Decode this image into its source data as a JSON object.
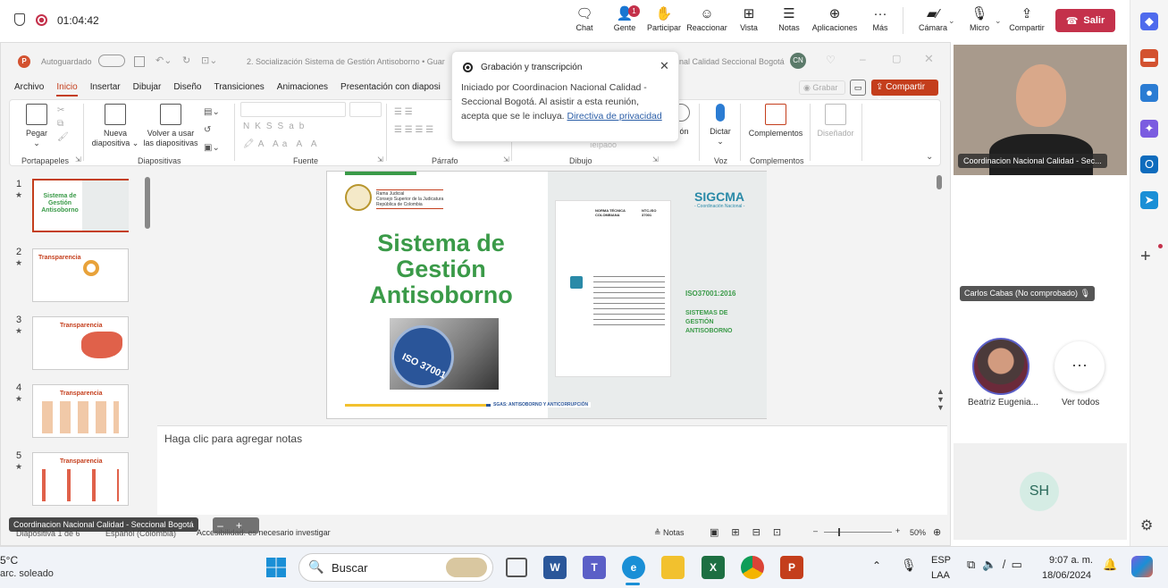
{
  "teams": {
    "timer": "01:04:42",
    "toolbar": [
      {
        "label": "Chat",
        "icon": "chat-icon"
      },
      {
        "label": "Gente",
        "icon": "people-icon"
      },
      {
        "label": "Participar",
        "icon": "raise-hand-icon"
      },
      {
        "label": "Reaccionar",
        "icon": "smiley-icon"
      },
      {
        "label": "Vista",
        "icon": "grid-icon"
      },
      {
        "label": "Notas",
        "icon": "notes-icon"
      },
      {
        "label": "Aplicaciones",
        "icon": "plus-icon"
      },
      {
        "label": "Más",
        "icon": "more-icon"
      },
      {
        "label": "Cámara",
        "icon": "camera-off-icon"
      },
      {
        "label": "Micro",
        "icon": "mic-off-icon"
      },
      {
        "label": "Compartir",
        "icon": "share-icon"
      }
    ],
    "people_badge": "1",
    "leave_label": "Salir"
  },
  "ppt": {
    "autosave": "Autoguardado",
    "doc_title": "2. Socialización Sistema de Gestión Antisoborno • Guar",
    "owner_title": "nal Calidad Seccional Bogotá",
    "avatar": "CN",
    "tabs": [
      "Archivo",
      "Inicio",
      "Insertar",
      "Dibujar",
      "Diseño",
      "Transiciones",
      "Animaciones",
      "Presentación con diaposi"
    ],
    "active_tab": "Inicio",
    "record_label": "Grabar",
    "share_label": "Compartir",
    "ribbon": {
      "paste": "Pegar",
      "new_slide": "Nueva diapositiva",
      "reuse": "Volver a usar las diapositivas",
      "dictate": "Dictar",
      "addins": "Complementos",
      "designer": "Diseñador",
      "drawing_hint": "ición",
      "groups": [
        "Portapapeles",
        "Diapositivas",
        "Fuente",
        "Párrafo",
        "Dibujo",
        "Voz",
        "Complementos"
      ]
    },
    "thumbnails": [
      {
        "num": "1",
        "title": "Sistema de Gestión Antisoborno"
      },
      {
        "num": "2",
        "title": "Transparencia"
      },
      {
        "num": "3",
        "title": "Transparencia"
      },
      {
        "num": "4",
        "title": "Transparencia"
      },
      {
        "num": "5",
        "title": "Transparencia"
      }
    ],
    "slide": {
      "org_line1": "Rama Judicial",
      "org_line2": "Consejo Superior de la Judicatura",
      "org_line3": "República de Colombia",
      "title": "Sistema de Gestión Antisoborno",
      "seal_text": "ISO 37001",
      "brand": "SIGCMA",
      "brand_sub": "- Coordinación Nacional -",
      "doc_header": "NORMA TÉCNICA COLOMBIANA",
      "doc_code": "NTC-ISO 37001",
      "iso_label": "ISO37001:2016",
      "iso_sub": "SISTEMAS DE GESTIÓN ANTISOBORNO",
      "footer": "SGAS: ANTISOBORNO Y ANTICORRUPCIÓN"
    },
    "notes_placeholder": "Haga clic para agregar notas",
    "status": {
      "slide": "Diapositiva 1 de 6",
      "language": "Español (Colombia)",
      "accessibility": "Accesibilidad: es necesario investigar",
      "notes": "Notas",
      "zoom": "50%"
    },
    "presenter_label": "Coordinacion Nacional Calidad - Seccional Bogotá"
  },
  "notification": {
    "title": "Grabación y transcripción",
    "body": "Iniciado por Coordinacion Nacional Calidad - Seccional Bogotá. Al asistir a esta reunión, acepta que se le incluya.",
    "link": "Directiva de privacidad"
  },
  "participants": {
    "main_video_label": "Coordinacion Nacional Calidad - Sec...",
    "carlos_label": "Carlos Cabas (No comprobado)",
    "beatriz_label": "Beatriz Eugenia...",
    "see_all": "Ver todos",
    "sh_initials": "SH"
  },
  "taskbar": {
    "weather_temp": "5°C",
    "weather_desc": "arc. soleado",
    "search_label": "Buscar",
    "lang1": "ESP",
    "lang2": "LAA",
    "time": "9:07 a. m.",
    "date": "18/06/2024"
  },
  "colors": {
    "ppt_accent": "#c43e1c",
    "leave_red": "#c4314b",
    "slide_green": "#3a9a48",
    "brand_teal": "#2a8aa8"
  }
}
